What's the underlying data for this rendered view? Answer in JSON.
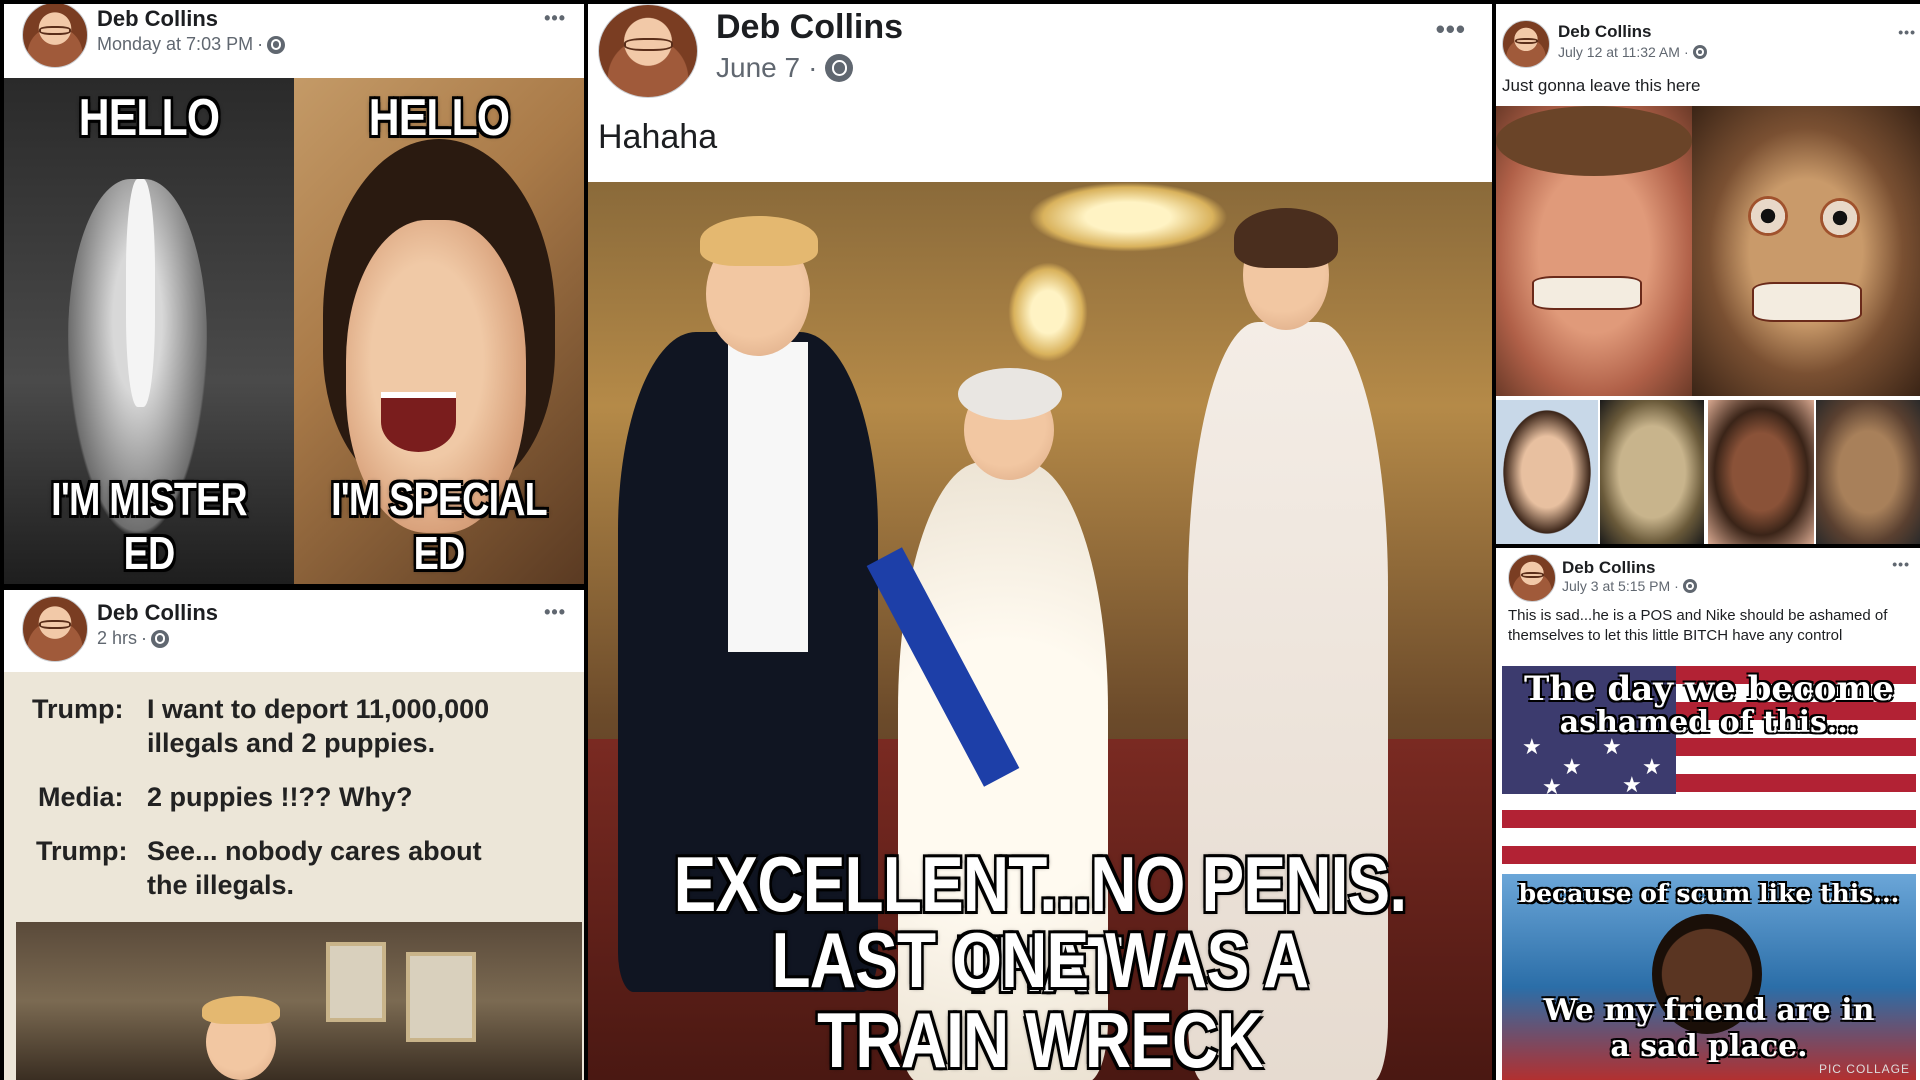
{
  "posts": [
    {
      "id": "post1",
      "author": "Deb Collins",
      "time": "Monday at 7:03 PM",
      "more": "•••",
      "meme": {
        "left_top": "HELLO",
        "left_bottom": "I'M MISTER ED",
        "right_top": "HELLO",
        "right_bottom": "I'M SPECIAL ED"
      }
    },
    {
      "id": "post2",
      "author": "Deb Collins",
      "time": "2 hrs",
      "more": "•••",
      "dialogue": [
        {
          "speaker": "Trump:",
          "line1": "I want to deport 11,000,000",
          "line2": "illegals and 2 puppies."
        },
        {
          "speaker": "Media:",
          "line1": "2 puppies !!??   Why?",
          "line2": ""
        },
        {
          "speaker": "Trump:",
          "line1": "See... nobody cares about",
          "line2": "the illegals."
        }
      ]
    },
    {
      "id": "post3",
      "author": "Deb Collins",
      "time": "June 7",
      "more": "•••",
      "caption": "Hahaha",
      "meme": {
        "line1": "EXCELLENT...NO PENIS. THAT",
        "line2": "LAST ONE WAS A TRAIN WRECK"
      }
    },
    {
      "id": "post4",
      "author": "Deb Collins",
      "time": "July 12 at 11:32 AM",
      "more": "•••",
      "caption": "Just gonna leave this here"
    },
    {
      "id": "post5",
      "author": "Deb Collins",
      "time": "July 3 at 5:15 PM",
      "more": "•••",
      "caption": "This is sad...he is a POS and Nike should be ashamed of themselves to let this little BITCH have any control",
      "meme": {
        "top1": "The day we become",
        "top2": "ashamed of this...",
        "mid": "because of scum like this...",
        "bottom1": "We my friend are in",
        "bottom2": "a sad place."
      },
      "watermark": "PIC COLLAGE"
    }
  ],
  "icons": {
    "privacy": "globe-icon",
    "more": "more-options-icon"
  },
  "colors": {
    "name": "#1c1e21",
    "meta": "#606770",
    "background": "#000000"
  }
}
